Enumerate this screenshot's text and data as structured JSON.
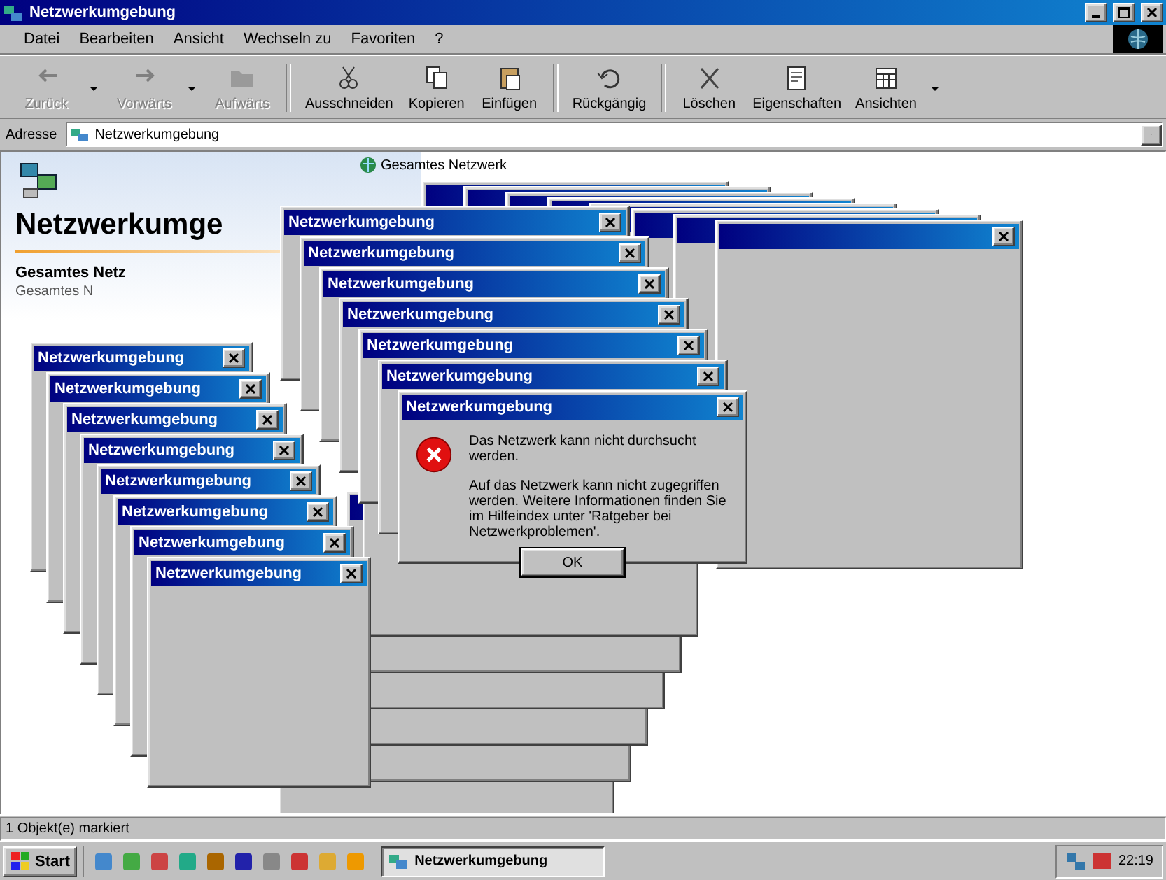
{
  "window": {
    "title": "Netzwerkumgebung"
  },
  "menu": [
    "Datei",
    "Bearbeiten",
    "Ansicht",
    "Wechseln zu",
    "Favoriten",
    "?"
  ],
  "toolbar": [
    {
      "label": "Zurück",
      "disabled": true,
      "dropdown": true
    },
    {
      "label": "Vorwärts",
      "disabled": true,
      "dropdown": true
    },
    {
      "label": "Aufwärts",
      "disabled": true,
      "dropdown": false
    },
    {
      "label": "Ausschneiden",
      "disabled": false,
      "dropdown": false
    },
    {
      "label": "Kopieren",
      "disabled": false,
      "dropdown": false
    },
    {
      "label": "Einfügen",
      "disabled": false,
      "dropdown": false
    },
    {
      "label": "Rückgängig",
      "disabled": false,
      "dropdown": false
    },
    {
      "label": "Löschen",
      "disabled": false,
      "dropdown": false
    },
    {
      "label": "Eigenschaften",
      "disabled": false,
      "dropdown": false
    },
    {
      "label": "Ansichten",
      "disabled": false,
      "dropdown": true
    }
  ],
  "address": {
    "label": "Adresse",
    "value": "Netzwerkumgebung"
  },
  "content": {
    "link": "Gesamtes Netzwerk",
    "heading": "Netzwerkumge",
    "selection_title": "Gesamtes Netz",
    "selection_subtitle": "Gesamtes N"
  },
  "dialog_cascade_left": [
    {
      "title": "Netzwerkumgebung"
    },
    {
      "title": "Netzwerkumgebung"
    },
    {
      "title": "Netzwerkumgebung"
    },
    {
      "title": "Netzwerkumgebung"
    },
    {
      "title": "Netzwerkumgebung"
    },
    {
      "title": "Netzwerkumgebung"
    },
    {
      "title": "Netzwerkumgebung"
    },
    {
      "title": "Netzwerkumgebung"
    }
  ],
  "dialog_cascade_center": [
    {
      "title": "Netzwerkumgebung"
    },
    {
      "title": "Netzwerkumgebung"
    },
    {
      "title": "Netzwerkumgebung"
    },
    {
      "title": "Netzwerkumgebung"
    },
    {
      "title": "Netzwerkumgebung"
    },
    {
      "title": "Netzwerkumgebung"
    }
  ],
  "error_dialog": {
    "title": "Netzwerkumgebung",
    "message": "Das Netzwerk kann nicht durchsucht werden.",
    "details": "Auf das Netzwerk kann nicht zugegriffen werden. Weitere Informationen finden Sie im Hilfeindex unter 'Ratgeber bei Netzwerkproblemen'.",
    "button": "OK"
  },
  "status_bar": "1 Objekt(e) markiert",
  "taskbar": {
    "start": "Start",
    "tasks": [
      {
        "label": "Netzwerkumgebung",
        "selected": true
      }
    ],
    "clock": "22:19"
  }
}
